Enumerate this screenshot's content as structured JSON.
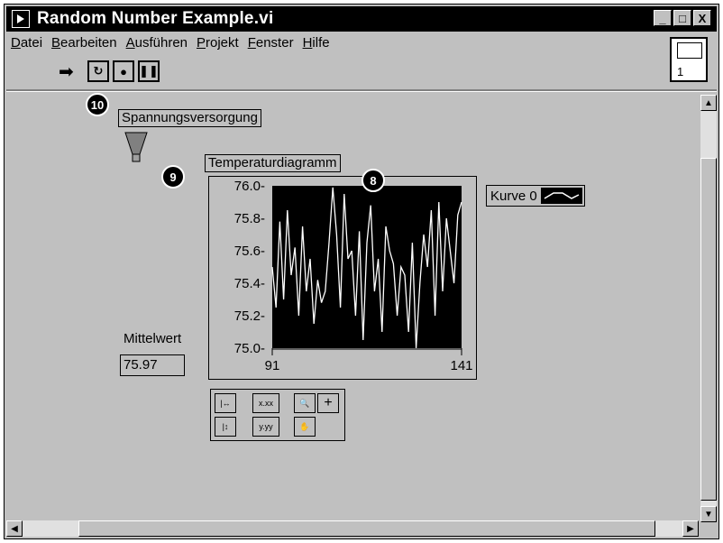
{
  "window": {
    "title": "Random Number Example.vi",
    "controls": [
      "_",
      "□",
      "X"
    ]
  },
  "menubar": [
    "Datei",
    "Bearbeiten",
    "Ausführen",
    "Projekt",
    "Fenster",
    "Hilfe"
  ],
  "connector": {
    "number": "1"
  },
  "front_panel": {
    "power_label": "Spannungsversorgung",
    "chart_label": "Temperaturdiagramm",
    "legend_label": "Kurve 0",
    "mean_label": "Mittelwert",
    "mean_value": "75.97",
    "callouts": [
      "10",
      "9",
      "8"
    ]
  },
  "palette": {
    "x_format": "x.xx",
    "y_format": "y.yy",
    "plus": "+"
  },
  "chart_data": {
    "type": "line",
    "title": "Temperaturdiagramm",
    "xlabel": "",
    "ylabel": "",
    "xlim": [
      91,
      141
    ],
    "ylim": [
      75.0,
      76.0
    ],
    "x_ticks": [
      "91",
      "141"
    ],
    "y_ticks": [
      "76.0",
      "75.8",
      "75.6",
      "75.4",
      "75.2",
      "75.0"
    ],
    "series": [
      {
        "name": "Kurve 0",
        "x": [
          91,
          92,
          93,
          94,
          95,
          96,
          97,
          98,
          99,
          100,
          101,
          102,
          103,
          104,
          105,
          106,
          107,
          108,
          109,
          110,
          111,
          112,
          113,
          114,
          115,
          116,
          117,
          118,
          119,
          120,
          121,
          122,
          123,
          124,
          125,
          126,
          127,
          128,
          129,
          130,
          131,
          132,
          133,
          134,
          135,
          136,
          137,
          138,
          139,
          140,
          141
        ],
        "values": [
          75.5,
          75.25,
          75.78,
          75.3,
          75.85,
          75.45,
          75.62,
          75.2,
          75.75,
          75.35,
          75.55,
          75.15,
          75.42,
          75.28,
          75.35,
          75.65,
          75.99,
          75.7,
          75.25,
          75.95,
          75.55,
          75.6,
          75.2,
          75.72,
          75.05,
          75.65,
          75.88,
          75.35,
          75.55,
          75.1,
          75.75,
          75.6,
          75.52,
          75.2,
          75.5,
          75.45,
          75.1,
          75.65,
          75.0,
          75.4,
          75.7,
          75.5,
          75.85,
          75.2,
          75.9,
          75.35,
          75.8,
          75.6,
          75.4,
          75.82,
          75.9
        ]
      }
    ]
  }
}
